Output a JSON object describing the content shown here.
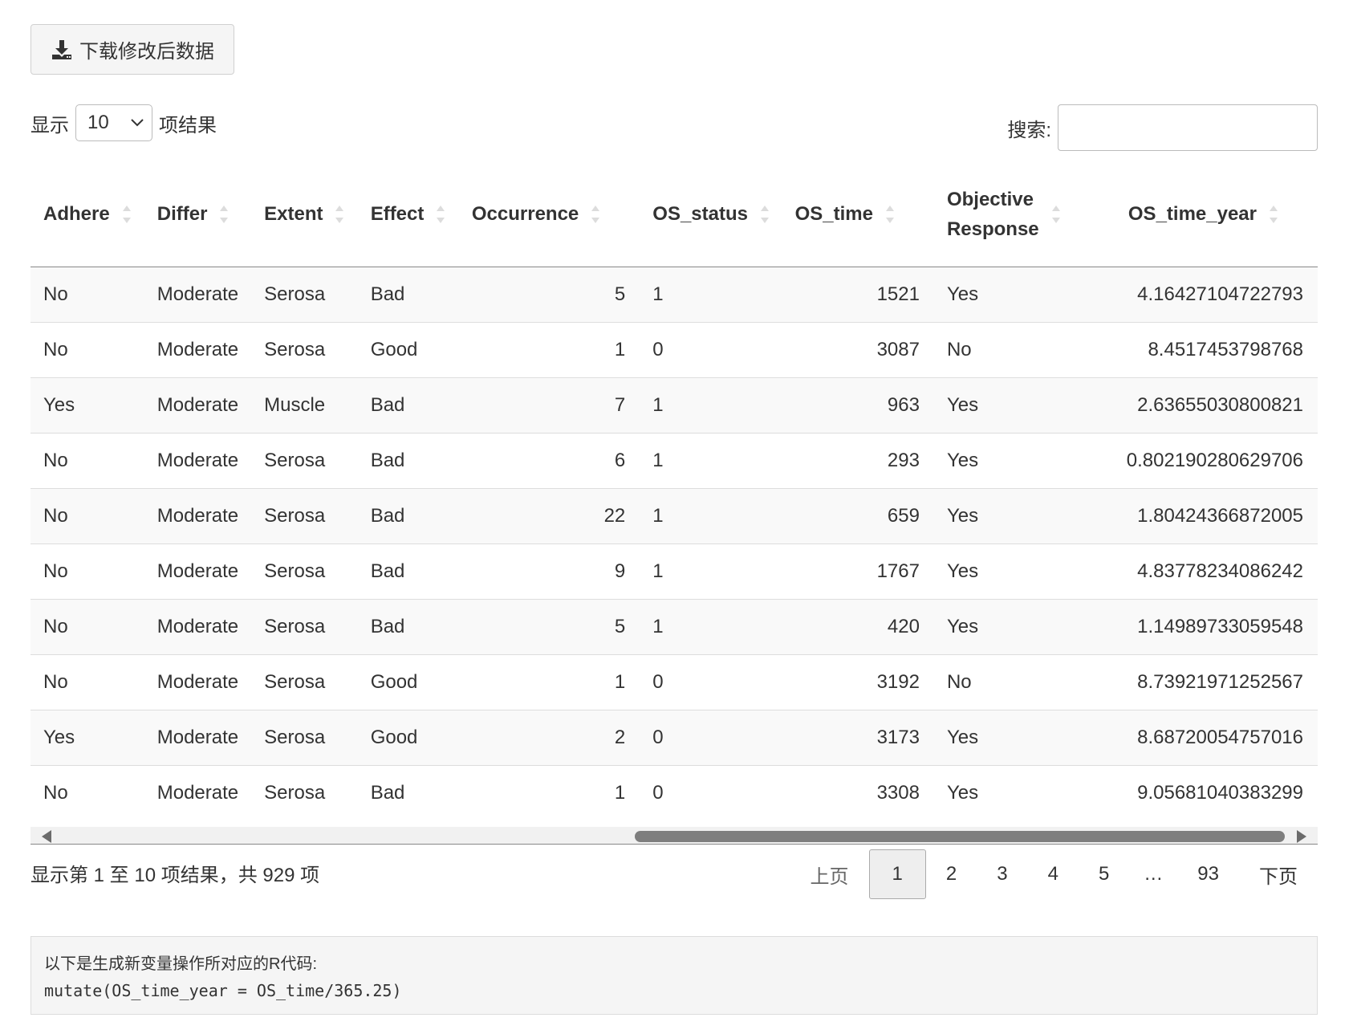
{
  "download_button": {
    "label": "下载修改后数据",
    "icon": "download-icon"
  },
  "length_menu": {
    "prefix": "显示",
    "selected": "10",
    "suffix": "项结果"
  },
  "search": {
    "label": "搜索:",
    "value": ""
  },
  "table": {
    "columns": [
      {
        "line1": "Adhere",
        "line2": "",
        "align": "left"
      },
      {
        "line1": "Differ",
        "line2": "",
        "align": "left"
      },
      {
        "line1": "Extent",
        "line2": "",
        "align": "left"
      },
      {
        "line1": "Effect",
        "line2": "",
        "align": "left"
      },
      {
        "line1": "Occurrence",
        "line2": "",
        "align": "right"
      },
      {
        "line1": "OS_status",
        "line2": "",
        "align": "left"
      },
      {
        "line1": "OS_time",
        "line2": "",
        "align": "right"
      },
      {
        "line1": "Objective",
        "line2": "Response",
        "align": "left"
      },
      {
        "line1": "OS_time_year",
        "line2": "",
        "align": "right"
      }
    ],
    "rows": [
      [
        "No",
        "Moderate",
        "Serosa",
        "Bad",
        "5",
        "1",
        "1521",
        "Yes",
        "4.16427104722793"
      ],
      [
        "No",
        "Moderate",
        "Serosa",
        "Good",
        "1",
        "0",
        "3087",
        "No",
        "8.4517453798768"
      ],
      [
        "Yes",
        "Moderate",
        "Muscle",
        "Bad",
        "7",
        "1",
        "963",
        "Yes",
        "2.63655030800821"
      ],
      [
        "No",
        "Moderate",
        "Serosa",
        "Bad",
        "6",
        "1",
        "293",
        "Yes",
        "0.802190280629706"
      ],
      [
        "No",
        "Moderate",
        "Serosa",
        "Bad",
        "22",
        "1",
        "659",
        "Yes",
        "1.80424366872005"
      ],
      [
        "No",
        "Moderate",
        "Serosa",
        "Bad",
        "9",
        "1",
        "1767",
        "Yes",
        "4.83778234086242"
      ],
      [
        "No",
        "Moderate",
        "Serosa",
        "Bad",
        "5",
        "1",
        "420",
        "Yes",
        "1.14989733059548"
      ],
      [
        "No",
        "Moderate",
        "Serosa",
        "Good",
        "1",
        "0",
        "3192",
        "No",
        "8.73921971252567"
      ],
      [
        "Yes",
        "Moderate",
        "Serosa",
        "Good",
        "2",
        "0",
        "3173",
        "Yes",
        "8.68720054757016"
      ],
      [
        "No",
        "Moderate",
        "Serosa",
        "Bad",
        "1",
        "0",
        "3308",
        "Yes",
        "9.05681040383299"
      ]
    ]
  },
  "info_text": "显示第 1 至 10 项结果，共 929 项",
  "pagination": {
    "prev": "上页",
    "pages": [
      "1",
      "2",
      "3",
      "4",
      "5"
    ],
    "ellipsis": "…",
    "last": "93",
    "next": "下页",
    "current": "1"
  },
  "code_block": {
    "caption": "以下是生成新变量操作所对应的R代码:",
    "code": "mutate(OS_time_year = OS_time/365.25)"
  }
}
